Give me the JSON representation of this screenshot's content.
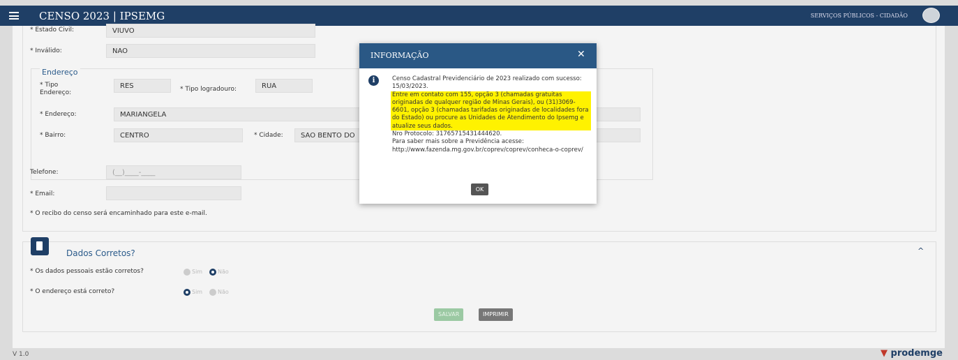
{
  "header": {
    "title": "CENSO 2023 | IPSEMG",
    "nav": "SERVIÇOS PÚBLICOS - CIDADÃO"
  },
  "personal": {
    "estado_civil_label": "* Estado Civil:",
    "estado_civil_value": "VIUVO",
    "invalido_label": "* Inválido:",
    "invalido_value": "NAO"
  },
  "address": {
    "legend": "Endereço",
    "tipo_endereco_label": "* Tipo Endereço:",
    "tipo_endereco_value": "RES",
    "tipo_logradouro_label": "* Tipo logradouro:",
    "tipo_logradouro_value": "RUA",
    "endereco_label": "* Endereço:",
    "endereco_value": "MARIANGELA",
    "bairro_label": "* Bairro:",
    "bairro_value": "CENTRO",
    "cidade_label": "* Cidade:",
    "cidade_value": "SAO BENTO DO"
  },
  "contact": {
    "telefone_label": "Telefone:",
    "telefone_placeholder": "(__)____-____",
    "email_label": "* Email:",
    "email_value": "",
    "receipt_note": "* O recibo do censo será encaminhado para este e-mail."
  },
  "confirm": {
    "title": "Dados Corretos?",
    "q1": "* Os dados pessoais estão corretos?",
    "q2": "* O endereço está correto?",
    "sim": "Sim",
    "nao": "Não",
    "save": "SALVAR",
    "print": "IMPRIMIR"
  },
  "modal": {
    "title": "INFORMAÇÃO",
    "line1": "Censo Cadastral Previdenciário de 2023 realizado com sucesso: 15/03/2023.",
    "highlight": "Entre em contato com 155, opção 3 (chamadas gratuitas originadas de qualquer região de Minas Gerais), ou (31)3069-6601, opção 3 (chamadas tarifadas originadas de localidades fora do Estado) ou procure as Unidades de Atendimento do Ipsemg e atualize seus dados.",
    "protocol": "Nro Protocolo: 31765715431444620.",
    "more": "Para saber mais sobre a Previdência acesse: http://www.fazenda.mg.gov.br/coprev/coprev/conheca-o-coprev/",
    "ok": "OK"
  },
  "footer": {
    "version": "V 1.0",
    "logo": "prodemge"
  }
}
